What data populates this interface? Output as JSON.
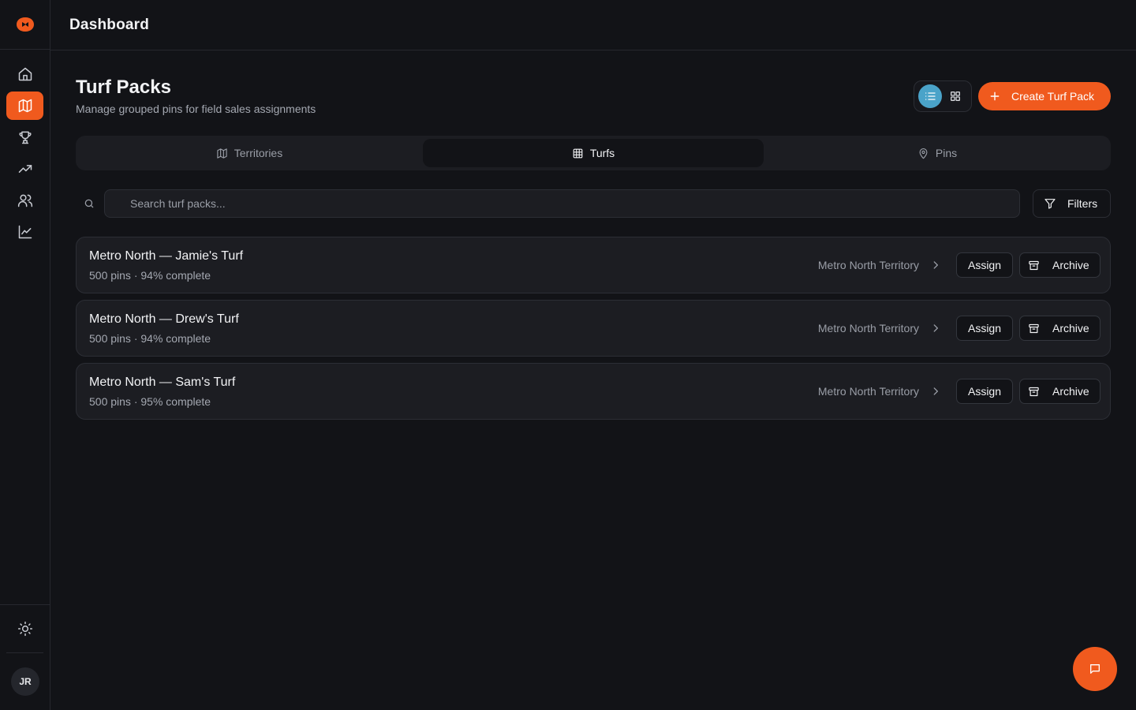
{
  "app": {
    "brand_color": "#f05a1e",
    "accent_color": "#4aa3c9"
  },
  "header": {
    "title": "Dashboard"
  },
  "sidebar": {
    "items": [
      {
        "icon": "home-icon",
        "active": false
      },
      {
        "icon": "map-icon",
        "active": true
      },
      {
        "icon": "trophy-icon",
        "active": false
      },
      {
        "icon": "trending-up-icon",
        "active": false
      },
      {
        "icon": "users-icon",
        "active": false
      },
      {
        "icon": "line-chart-icon",
        "active": false
      }
    ],
    "theme_icon": "sun-icon",
    "user_initials": "JR"
  },
  "page": {
    "title": "Turf Packs",
    "subtitle": "Manage grouped pins for field sales assignments",
    "view_mode": "list",
    "create_label": "Create Turf Pack"
  },
  "tabs": [
    {
      "label": "Territories",
      "icon": "map-icon",
      "active": false
    },
    {
      "label": "Turfs",
      "icon": "grid-icon",
      "active": true
    },
    {
      "label": "Pins",
      "icon": "map-pin-icon",
      "active": false
    }
  ],
  "search": {
    "placeholder": "Search turf packs...",
    "value": ""
  },
  "filters_label": "Filters",
  "turf_packs": [
    {
      "name": "Metro North — Jamie's Turf",
      "meta": "500 pins · 94% complete",
      "territory": "Metro North Territory",
      "assign_label": "Assign",
      "archive_label": "Archive"
    },
    {
      "name": "Metro North — Drew's Turf",
      "meta": "500 pins · 94% complete",
      "territory": "Metro North Territory",
      "assign_label": "Assign",
      "archive_label": "Archive"
    },
    {
      "name": "Metro North — Sam's Turf",
      "meta": "500 pins · 95% complete",
      "territory": "Metro North Territory",
      "assign_label": "Assign",
      "archive_label": "Archive"
    }
  ],
  "chat_icon": "message-square-icon"
}
